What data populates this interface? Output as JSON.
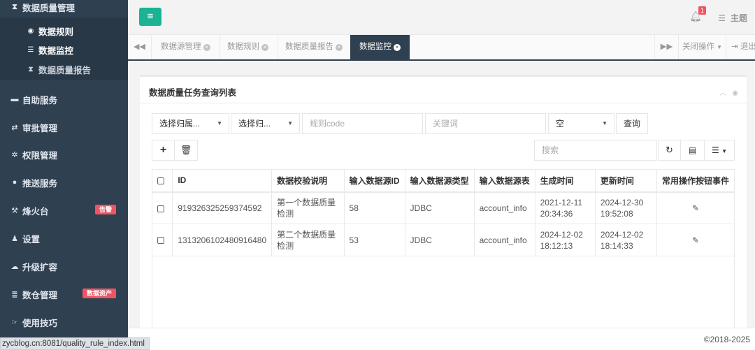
{
  "sidebar": {
    "group_title": "数据质量管理",
    "sub_items": [
      {
        "label": "数据规则",
        "icon": "eye-icon"
      },
      {
        "label": "数据监控",
        "icon": "list-icon"
      },
      {
        "label": "数据质量报告",
        "icon": "hourglass-icon"
      }
    ],
    "items": [
      {
        "label": "自助服务",
        "icon": "coffee-icon"
      },
      {
        "label": "审批管理",
        "icon": "exchange-icon"
      },
      {
        "label": "权限管理",
        "icon": "gear-icon"
      },
      {
        "label": "推送服务",
        "icon": "comment-icon"
      },
      {
        "label": "烽火台",
        "icon": "gavel-icon",
        "badge": "告警"
      },
      {
        "label": "设置",
        "icon": "user-icon"
      },
      {
        "label": "升级扩容",
        "icon": "cloud-icon"
      },
      {
        "label": "数仓管理",
        "icon": "database-icon",
        "badge": "数据资产"
      },
      {
        "label": "使用技巧",
        "icon": "hand-icon"
      }
    ]
  },
  "header": {
    "notification_count": "1",
    "theme_label": "主题"
  },
  "tabs": {
    "items": [
      {
        "label": "数据源管理"
      },
      {
        "label": "数据规则"
      },
      {
        "label": "数据质量报告"
      },
      {
        "label": "数据监控",
        "active": true
      }
    ],
    "close_ops": "关闭操作",
    "logout": "退出"
  },
  "panel": {
    "title": "数据质量任务查询列表",
    "filters": {
      "belong1": "选择归属...",
      "belong2": "选择归...",
      "rule_code_placeholder": "规则code",
      "keyword_placeholder": "关键词",
      "empty_select": "空",
      "query_label": "查询"
    },
    "search_placeholder": "搜索"
  },
  "table": {
    "headers": [
      "ID",
      "数据校验说明",
      "输入数据源ID",
      "输入数据源类型",
      "输入数据源表",
      "生成时间",
      "更新时间",
      "常用操作按钮事件"
    ],
    "rows": [
      {
        "id": "919326325259374592",
        "desc": "第一个数据质量检测",
        "source_id": "58",
        "source_type": "JDBC",
        "source_table": "account_info",
        "created": "2021-12-11 20:34:36",
        "updated": "2024-12-30 19:52:08"
      },
      {
        "id": "1313206102480916480",
        "desc": "第二个数据质量检测",
        "source_id": "53",
        "source_type": "JDBC",
        "source_table": "account_info",
        "created": "2024-12-02 18:12:13",
        "updated": "2024-12-02 18:14:33"
      }
    ]
  },
  "footer": {
    "copyright": "©2018-2025",
    "status_url": "zycblog.cn:8081/quality_rule_index.html"
  },
  "colors": {
    "sidebar_bg": "#2f4050",
    "accent": "#1ab394",
    "badge": "#ed5565"
  }
}
